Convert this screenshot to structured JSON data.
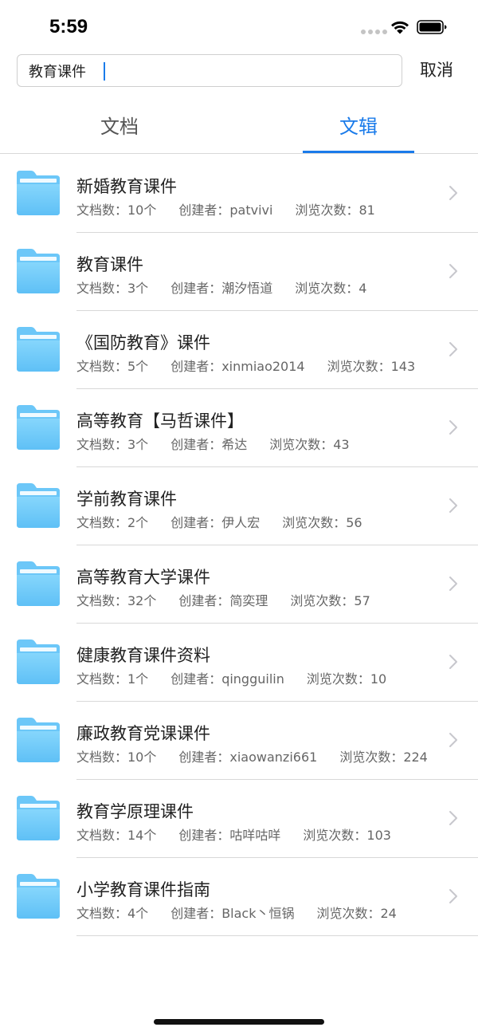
{
  "status_bar": {
    "time": "5:59"
  },
  "search": {
    "value": "教育课件",
    "cancel_label": "取消"
  },
  "tabs": [
    {
      "label": "文档",
      "active": false
    },
    {
      "label": "文辑",
      "active": true
    }
  ],
  "colors": {
    "accent": "#1a7bea",
    "folder_top": "#7fd3fb",
    "folder_bottom": "#5bbef5"
  },
  "items": [
    {
      "title": "新婚教育课件",
      "docs": "文档数：10个",
      "creator": "创建者：patvivi",
      "views": "浏览次数：81"
    },
    {
      "title": "教育课件",
      "docs": "文档数：3个",
      "creator": "创建者：潮汐悟道",
      "views": "浏览次数：4"
    },
    {
      "title": "《国防教育》课件",
      "docs": "文档数：5个",
      "creator": "创建者：xinmiao2014",
      "views": "浏览次数：143"
    },
    {
      "title": "高等教育【马哲课件】",
      "docs": "文档数：3个",
      "creator": "创建者：希达",
      "views": "浏览次数：43"
    },
    {
      "title": "学前教育课件",
      "docs": "文档数：2个",
      "creator": "创建者：伊人宏",
      "views": "浏览次数：56"
    },
    {
      "title": "高等教育大学课件",
      "docs": "文档数：32个",
      "creator": "创建者：简奕理",
      "views": "浏览次数：57"
    },
    {
      "title": "健康教育课件资料",
      "docs": "文档数：1个",
      "creator": "创建者：qingguilin",
      "views": "浏览次数：10"
    },
    {
      "title": "廉政教育党课课件",
      "docs": "文档数：10个",
      "creator": "创建者：xiaowanzi661",
      "views": "浏览次数：224"
    },
    {
      "title": "教育学原理课件",
      "docs": "文档数：14个",
      "creator": "创建者：咕咩咕咩",
      "views": "浏览次数：103"
    },
    {
      "title": "小学教育课件指南",
      "docs": "文档数：4个",
      "creator": "创建者：Black丶恒锅",
      "views": "浏览次数：24"
    }
  ]
}
